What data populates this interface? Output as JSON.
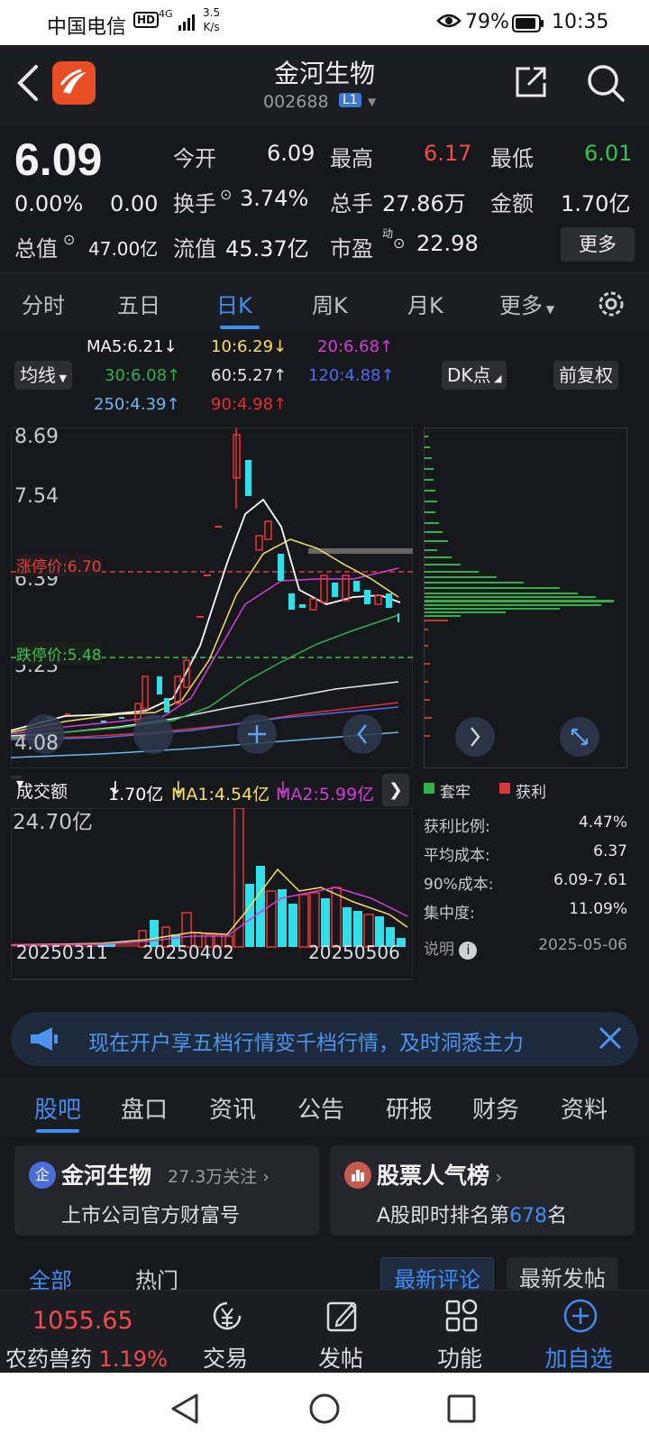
{
  "status_bar": {
    "carrier": "中国电信",
    "hd": "HD",
    "net": "4G",
    "speed_value": "3.5",
    "speed_unit": "K/s",
    "battery_pct": "79%",
    "time": "10:35"
  },
  "header": {
    "title": "金河生物",
    "code": "002688",
    "level": "L1"
  },
  "quote": {
    "price": "6.09",
    "change_pct": "0.00%",
    "change": "0.00",
    "open_label": "今开",
    "open": "6.09",
    "high_label": "最高",
    "high": "6.17",
    "low_label": "最低",
    "low": "6.01",
    "turnover_label": "换手",
    "turnover": "3.74%",
    "volume_label": "总手",
    "volume": "27.86万",
    "amount_label": "金额",
    "amount": "1.70亿",
    "mktcap_label": "总值",
    "mktcap": "47.00亿",
    "float_label": "流值",
    "float": "45.37亿",
    "pe_label": "市盈",
    "pe_sup": "动",
    "pe": "22.98",
    "more": "更多"
  },
  "period_tabs": [
    "分时",
    "五日",
    "日K",
    "周K",
    "月K",
    "更多"
  ],
  "active_period": "日K",
  "ma_legend": {
    "ma5": "MA5:6.21",
    "ma10": "10:6.29",
    "ma20": "20:6.68",
    "ma30": "30:6.08",
    "ma60": "60:5.27",
    "ma120": "120:4.88",
    "ma250": "250:4.39",
    "ma90": "90:4.98",
    "ma_btn": "均线",
    "dk_btn": "DK点",
    "adj_btn": "前复权",
    "colors": {
      "ma5": "#ffffff",
      "ma10": "#f5e05a",
      "ma20": "#d23ed6",
      "ma30": "#2fb24a",
      "ma60": "#e8e8e8",
      "ma120": "#4a6cf0",
      "ma250": "#6ab8f0",
      "ma90": "#e03030"
    }
  },
  "kline": {
    "y_labels": [
      "8.69",
      "7.54",
      "6.39",
      "5.23",
      "4.08"
    ],
    "limit_up": "涨停价:6.70",
    "limit_down": "跌停价:5.48"
  },
  "volume": {
    "label": "成交额",
    "value": "1.70亿",
    "ma1": "MA1:4.54亿",
    "ma2": "MA2:5.99亿",
    "max": "24.70亿",
    "dates": [
      "20250311",
      "20250402",
      "20250506"
    ]
  },
  "chips": {
    "legend_hold": "套牢",
    "legend_profit": "获利",
    "stats": [
      {
        "k": "获利比例:",
        "v": "4.47%"
      },
      {
        "k": "平均成本:",
        "v": "6.37"
      },
      {
        "k": "90%成本:",
        "v": "6.09-7.61"
      },
      {
        "k": "集中度:",
        "v": "11.09%"
      }
    ],
    "note": "说明",
    "date": "2025-05-06"
  },
  "banner": {
    "text": "现在开户享五档行情变千档行情，及时洞悉主力"
  },
  "section_tabs": [
    "股吧",
    "盘口",
    "资讯",
    "公告",
    "研报",
    "财务",
    "资料"
  ],
  "cards": [
    {
      "name": "金河生物",
      "sub": "27.3万关注",
      "desc": "上市公司官方财富号"
    },
    {
      "name": "股票人气榜",
      "desc_prefix": "A股即时排名第",
      "rank": "678",
      "desc_suffix": "名"
    }
  ],
  "feed_tabs": {
    "all": "全部",
    "hot": "热门",
    "latest_comment": "最新评论",
    "latest_post": "最新发帖"
  },
  "bottom_bar": {
    "index_value": "1055.65",
    "index_name": "农药兽药",
    "index_pct": "1.19%",
    "trade": "交易",
    "post": "发帖",
    "func": "功能",
    "add": "加自选"
  }
}
